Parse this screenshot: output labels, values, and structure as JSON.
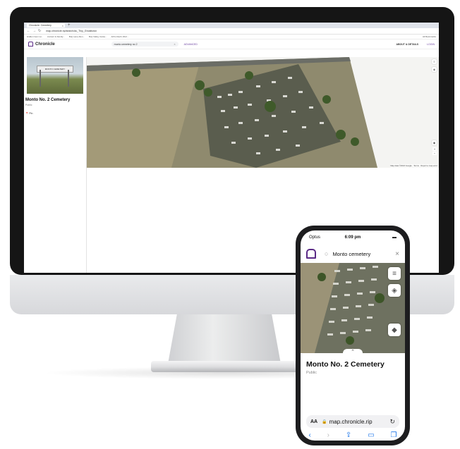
{
  "desktop": {
    "tab_title": "Chronicle: Cemetery",
    "url": "map.chronicle.rip/search/ac_Tiny_Ghosttown",
    "bookmarks": [
      "Hidden Gem wi...",
      "Ancient & Family...",
      "Burj Lane Afen...",
      "Burj Valley Canta...",
      "Arfiro Red's Worl..."
    ],
    "bookmarks_right": "All Bookmarks",
    "app_name": "Chronicle",
    "search_value": "monto cemetery no 2",
    "advanced_label": "ADVANCED",
    "about_label": "ABOUT & DETAILS",
    "login_label": "LOGIN",
    "photo_sign_text": "MONTO CEMETERY",
    "place_title": "Monto No. 2 Cemetery",
    "place_sub": "Public",
    "pin_label": "Pin",
    "map_attribution": "Map data ©2024 Google · Terms · Report a map error"
  },
  "phone": {
    "carrier": "Optus",
    "time": "6:09 pm",
    "search_value": "Monto cemetery",
    "place_title": "Monto No. 2 Cemetery",
    "place_sub": "Public",
    "url": "map.chronicle.rip",
    "aa_label": "AA"
  },
  "icons": [
    "chronicle-logo-icon",
    "search-icon",
    "close-icon",
    "layers-icon",
    "filter-icon",
    "locate-icon",
    "chevron-up-icon",
    "back-icon",
    "forward-icon",
    "share-icon",
    "bookmarks-icon",
    "tabs-icon",
    "reload-icon",
    "lock-icon"
  ],
  "colors": {
    "brand": "#5b2a86",
    "accent": "#6b3fa0",
    "ios_blue": "#1a73e8"
  }
}
